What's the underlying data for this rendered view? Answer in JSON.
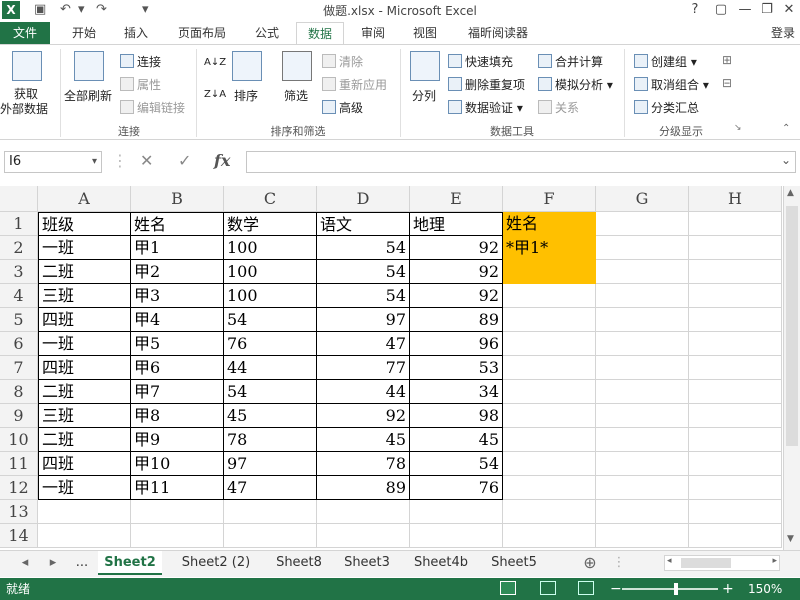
{
  "window": {
    "title": "做题.xlsx - Microsoft Excel",
    "logo": "X",
    "help": "?",
    "minimize": "—",
    "restore": "❐",
    "close": "✕",
    "login": "登录"
  },
  "qat": {
    "save": "💾",
    "undo": "↶",
    "redo": "↷",
    "more": "▾"
  },
  "tabs": {
    "file": "文件",
    "home": "开始",
    "insert": "插入",
    "layout": "页面布局",
    "formulas": "公式",
    "data": "数据",
    "review": "审阅",
    "view": "视图",
    "foxit": "福昕阅读器"
  },
  "ribbon": {
    "get_external": "获取",
    "get_external2": "外部数据",
    "refresh_all": "全部刷新",
    "connections": "连接",
    "properties": "属性",
    "edit_links": "编辑链接",
    "group_connections": "连接",
    "sort_az": "A↓Z",
    "sort_za": "Z↓A",
    "sort": "排序",
    "filter": "筛选",
    "clear": "清除",
    "reapply": "重新应用",
    "advanced": "高级",
    "group_sort": "排序和筛选",
    "text_to_cols": "分列",
    "flash_fill": "快速填充",
    "remove_dup": "删除重复项",
    "validation": "数据验证",
    "consolidate": "合并计算",
    "whatif": "模拟分析",
    "relationships": "关系",
    "group_tools": "数据工具",
    "group_create": "创建组",
    "ungroup": "取消组合",
    "subtotal": "分类汇总",
    "group_outline": "分级显示"
  },
  "formula_bar": {
    "name_box": "I6",
    "cancel": "✕",
    "enter": "✓",
    "fx": "fx",
    "value": ""
  },
  "columns": [
    "A",
    "B",
    "C",
    "D",
    "E",
    "F",
    "G",
    "H"
  ],
  "rows": [
    "1",
    "2",
    "3",
    "4",
    "5",
    "6",
    "7",
    "8",
    "9",
    "10",
    "11",
    "12",
    "13",
    "14"
  ],
  "table": {
    "header": [
      "班级",
      "姓名",
      "数学",
      "语文",
      "地理"
    ],
    "data": [
      [
        "一班",
        "甲1",
        "100",
        "54",
        "92"
      ],
      [
        "二班",
        "甲2",
        "100",
        "54",
        "92"
      ],
      [
        "三班",
        "甲3",
        "100",
        "54",
        "92"
      ],
      [
        "四班",
        "甲4",
        "54",
        "97",
        "89"
      ],
      [
        "一班",
        "甲5",
        "76",
        "47",
        "96"
      ],
      [
        "四班",
        "甲6",
        "44",
        "77",
        "53"
      ],
      [
        "二班",
        "甲7",
        "54",
        "44",
        "34"
      ],
      [
        "三班",
        "甲8",
        "45",
        "92",
        "98"
      ],
      [
        "二班",
        "甲9",
        "78",
        "45",
        "45"
      ],
      [
        "四班",
        "甲10",
        "97",
        "78",
        "54"
      ],
      [
        "一班",
        "甲11",
        "47",
        "89",
        "76"
      ]
    ]
  },
  "criteria": {
    "header": "姓名",
    "value": "*甲1*",
    "fill": "#ffc000"
  },
  "sheets": {
    "nav_prev": "◂",
    "nav_next": "▸",
    "more": "...",
    "tabs": [
      "Sheet2",
      "Sheet2 (2)",
      "Sheet8",
      "Sheet3",
      "Sheet4b",
      "Sheet5"
    ],
    "add": "⊕"
  },
  "status": {
    "ready": "就绪",
    "zoom": "150%",
    "minus": "−",
    "plus": "+"
  },
  "colors": {
    "accent": "#217346",
    "grid_line": "#d4d4d4",
    "border": "#000000"
  }
}
